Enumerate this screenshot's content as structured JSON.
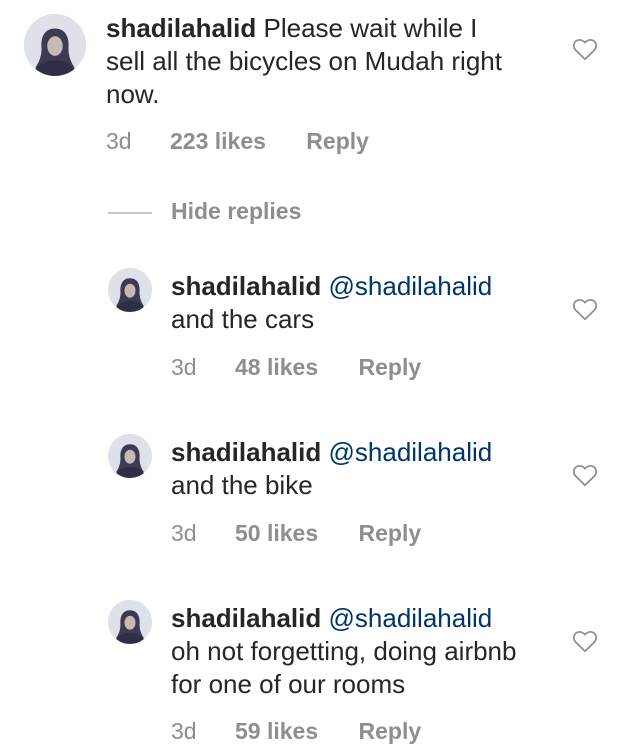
{
  "colors": {
    "text": "#262626",
    "secondary": "#8e8e8e",
    "mention": "#003569",
    "divider": "#c7c7c7"
  },
  "main_comment": {
    "username": "shadilahalid",
    "text": "Please wait while I sell all the bicycles on Mudah right now.",
    "time": "3d",
    "likes": "223 likes",
    "reply_label": "Reply",
    "avatar_icon": "avatar-icon",
    "like_icon": "heart-outline-icon"
  },
  "hide_replies_label": "Hide replies",
  "replies": [
    {
      "username": "shadilahalid",
      "mention": "@shadilahalid",
      "text": "and the cars",
      "time": "3d",
      "likes": "48 likes",
      "reply_label": "Reply",
      "avatar_icon": "avatar-icon",
      "like_icon": "heart-outline-icon"
    },
    {
      "username": "shadilahalid",
      "mention": "@shadilahalid",
      "text": "and the bike",
      "time": "3d",
      "likes": "50 likes",
      "reply_label": "Reply",
      "avatar_icon": "avatar-icon",
      "like_icon": "heart-outline-icon"
    },
    {
      "username": "shadilahalid",
      "mention": "@shadilahalid",
      "text": "oh not forgetting, doing airbnb for one of our rooms",
      "time": "3d",
      "likes": "59 likes",
      "reply_label": "Reply",
      "avatar_icon": "avatar-icon",
      "like_icon": "heart-outline-icon"
    }
  ]
}
